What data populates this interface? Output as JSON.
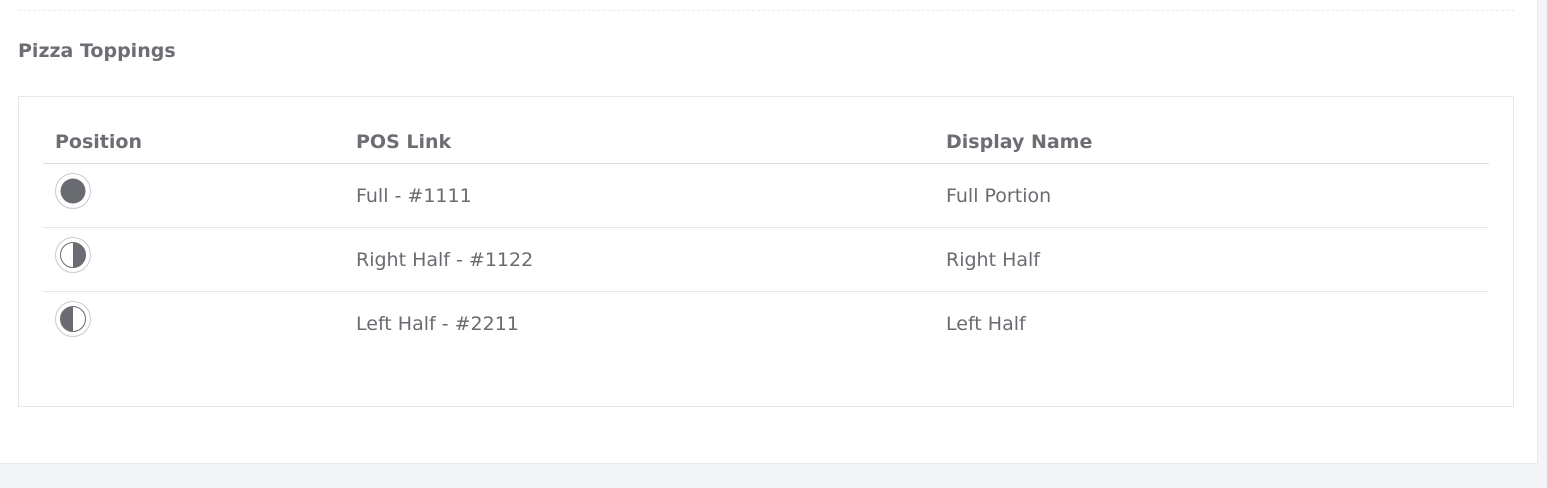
{
  "section": {
    "title": "Pizza Toppings"
  },
  "table": {
    "headers": [
      "Position",
      "POS Link",
      "Display Name"
    ],
    "rows": [
      {
        "position_icon": "full-circle-icon",
        "pos_link": "Full - #1111",
        "display_name": "Full Portion"
      },
      {
        "position_icon": "right-half-circle-icon",
        "pos_link": "Right Half - #1122",
        "display_name": "Right Half"
      },
      {
        "position_icon": "left-half-circle-icon",
        "pos_link": "Left Half - #2211",
        "display_name": "Left Half"
      }
    ]
  },
  "colors": {
    "icon_fill": "#6b6c71",
    "icon_ring": "#c9cacf"
  }
}
